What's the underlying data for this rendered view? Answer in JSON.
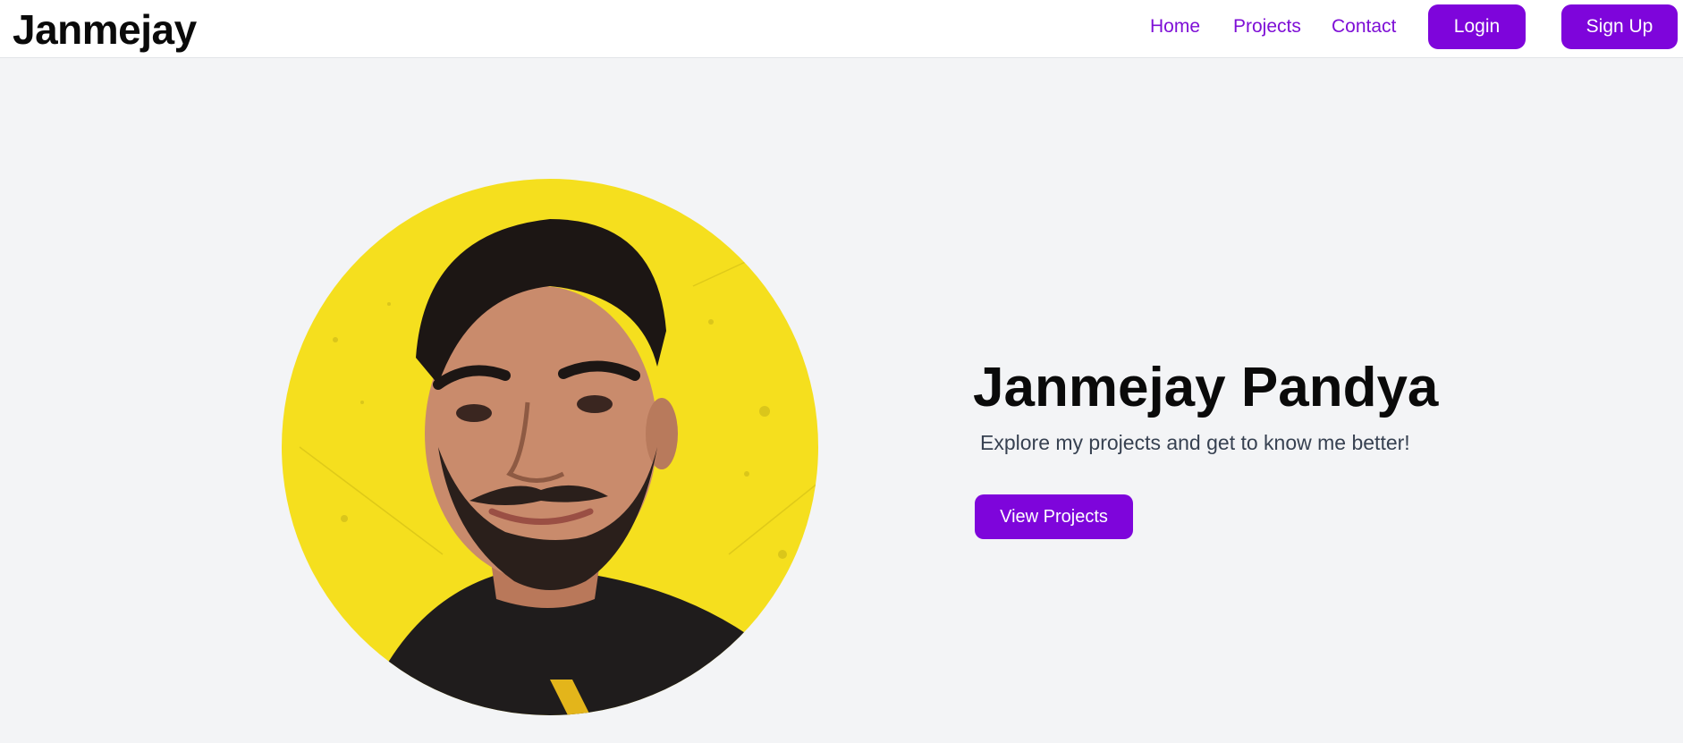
{
  "navbar": {
    "brand": "Janmejay",
    "links": [
      {
        "label": "Home"
      },
      {
        "label": "Projects"
      },
      {
        "label": "Contact"
      }
    ],
    "login_label": "Login",
    "signup_label": "Sign Up"
  },
  "hero": {
    "title": "Janmejay Pandya",
    "subtitle": "Explore my projects and get to know me better!",
    "cta_label": "View Projects"
  },
  "colors": {
    "accent": "#7e05db",
    "link": "#7e0fd6",
    "background": "#f3f4f6",
    "portrait_background": "#f5df1e"
  }
}
